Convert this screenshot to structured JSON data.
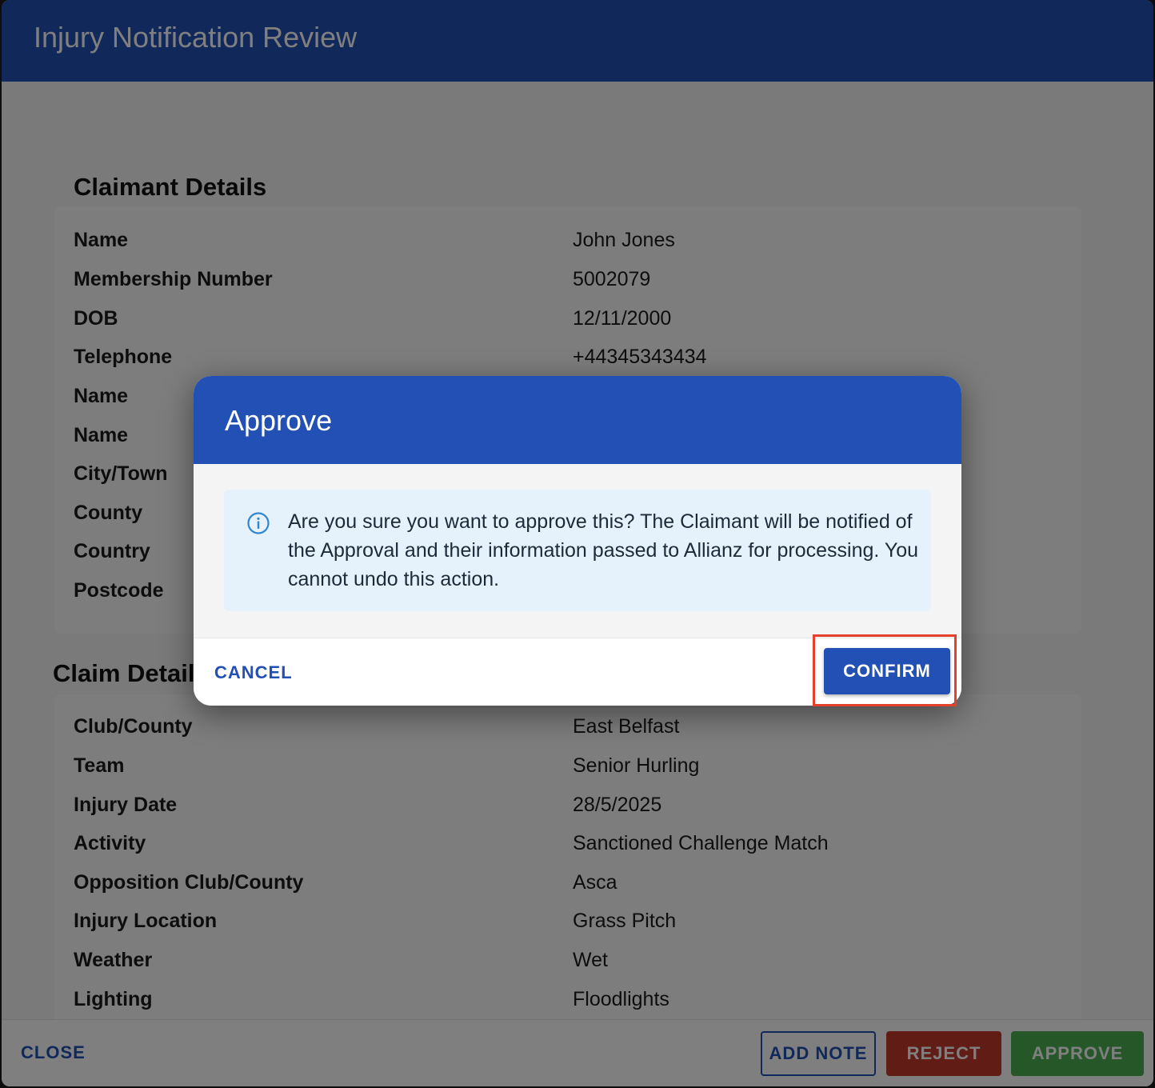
{
  "dialog": {
    "title": "Injury Notification Review",
    "sections": {
      "claimant": {
        "heading": "Claimant Details",
        "rows": [
          {
            "label": "Name",
            "value": "John Jones"
          },
          {
            "label": "Membership Number",
            "value": "5002079"
          },
          {
            "label": "DOB",
            "value": "12/11/2000"
          },
          {
            "label": "Telephone",
            "value": "+44345343434"
          },
          {
            "label": "Name",
            "value": ""
          },
          {
            "label": "Name",
            "value": ""
          },
          {
            "label": "City/Town",
            "value": ""
          },
          {
            "label": "County",
            "value": ""
          },
          {
            "label": "Country",
            "value": ""
          },
          {
            "label": "Postcode",
            "value": ""
          }
        ]
      },
      "claim": {
        "heading": "Claim Details",
        "rows": [
          {
            "label": "Club/County",
            "value": "East Belfast"
          },
          {
            "label": "Team",
            "value": "Senior Hurling"
          },
          {
            "label": "Injury Date",
            "value": "28/5/2025"
          },
          {
            "label": "Activity",
            "value": "Sanctioned Challenge Match"
          },
          {
            "label": "Opposition Club/County",
            "value": "Asca"
          },
          {
            "label": "Injury Location",
            "value": "Grass Pitch"
          },
          {
            "label": "Weather",
            "value": "Wet"
          },
          {
            "label": "Lighting",
            "value": "Floodlights"
          }
        ]
      }
    },
    "footer": {
      "close_label": "CLOSE",
      "add_note_label": "ADD NOTE",
      "reject_label": "REJECT",
      "approve_label": "APPROVE"
    }
  },
  "modal": {
    "title": "Approve",
    "info_icon": "info-icon",
    "message": "Are you sure you want to approve this? The Claimant will be notified of the Approval and their information passed to Allianz for processing. You cannot undo this action.",
    "cancel_label": "CANCEL",
    "confirm_label": "CONFIRM"
  },
  "colors": {
    "primary": "#2250b4",
    "reject": "#c0392b",
    "approve": "#4caf50",
    "highlight": "#e5402a",
    "alert_bg": "#e6f2fb"
  }
}
